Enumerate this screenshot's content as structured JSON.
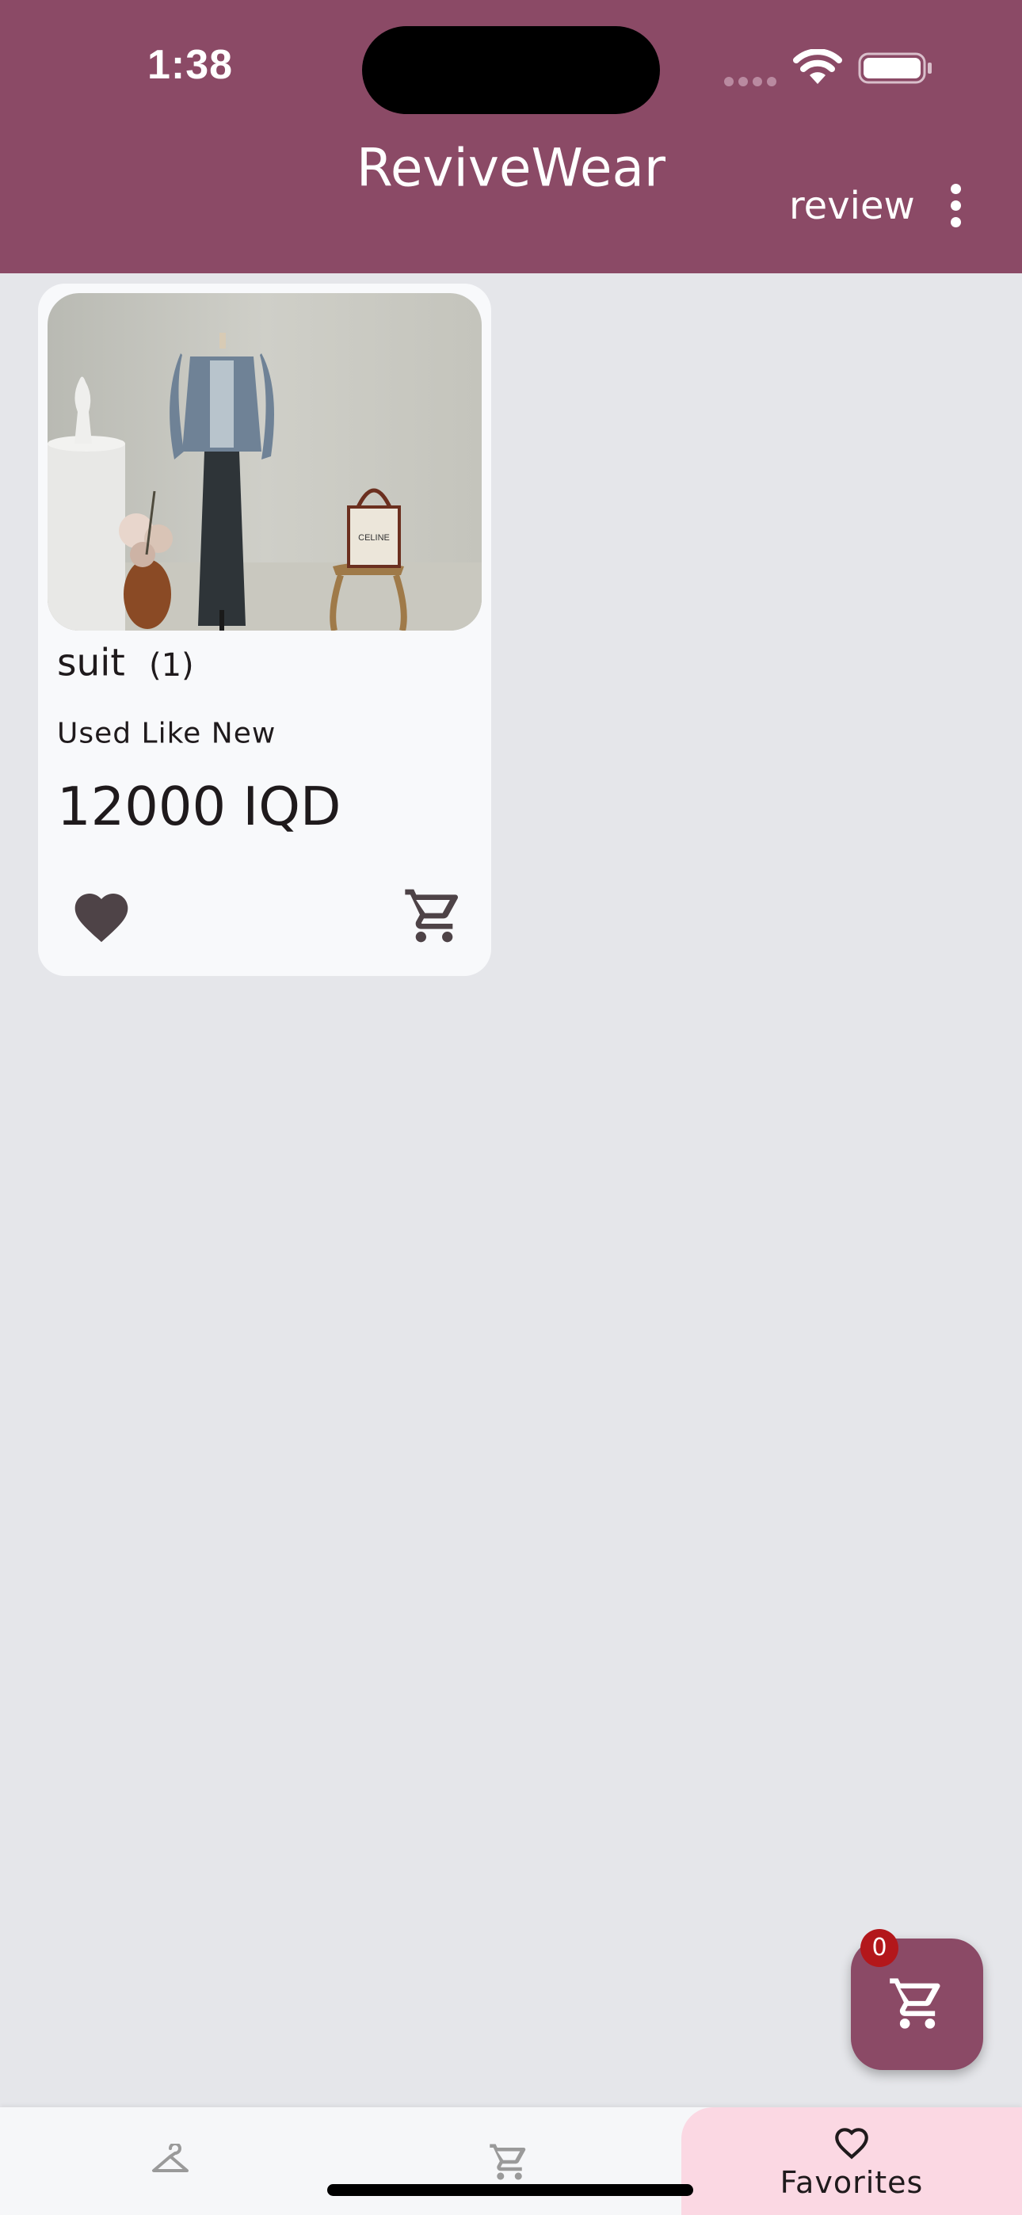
{
  "status_bar": {
    "time": "1:38"
  },
  "app_bar": {
    "title": "ReviveWear",
    "action_label": "review"
  },
  "product": {
    "name": "suit",
    "quantity": "(1)",
    "condition": "Used Like New",
    "price": "12000 IQD",
    "favorited": true
  },
  "fab": {
    "badge_count": "0"
  },
  "bottom_nav": {
    "items": [
      {
        "icon": "hanger-icon",
        "label": ""
      },
      {
        "icon": "cart-icon",
        "label": ""
      },
      {
        "icon": "heart-outline-icon",
        "label": "Favorites",
        "active": true
      }
    ]
  },
  "colors": {
    "primary": "#8b4a66",
    "background": "#e5e6ea",
    "card": "#f8f9fb",
    "active_nav": "#fbd8e3",
    "badge": "#b3171b"
  }
}
